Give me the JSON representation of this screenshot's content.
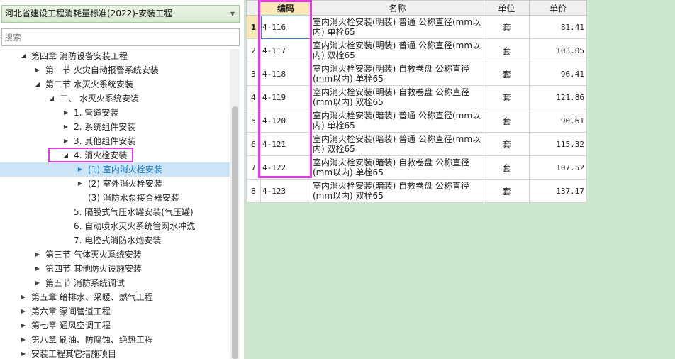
{
  "standard_selector": {
    "value": "河北省建设工程消耗量标准(2022)-安装工程"
  },
  "search": {
    "placeholder": "搜索"
  },
  "tree": [
    {
      "label": "第四章 消防设备安装工程",
      "expanded": true
    },
    {
      "label": "第一节 火灾自动报警系统安装",
      "expanded": false
    },
    {
      "label": "第二节 水灭火系统安装",
      "expanded": true
    },
    {
      "label": "二、 水灭火系统安装",
      "expanded": true
    },
    {
      "label": "1. 管道安装",
      "expanded": false
    },
    {
      "label": "2. 系统组件安装",
      "expanded": false
    },
    {
      "label": "3. 其他组件安装",
      "expanded": false
    },
    {
      "label": "4. 消火栓安装",
      "expanded": true,
      "highlighted": true
    },
    {
      "label": "(1) 室内消火栓安装",
      "expanded": false,
      "selected": true
    },
    {
      "label": "(2) 室外消火栓安装",
      "expanded": false
    },
    {
      "label": "(3) 消防水泵接合器安装",
      "leaf": true
    },
    {
      "label": "5. 隔膜式气压水罐安装(气压罐)",
      "leaf": true
    },
    {
      "label": "6. 自动喷水灭火系统管网水冲洗",
      "leaf": true
    },
    {
      "label": "7. 电控式消防水炮安装",
      "leaf": true
    },
    {
      "label": "第三节 气体灭火系统安装",
      "expanded": false
    },
    {
      "label": "第四节 其他防火设施安装",
      "expanded": false
    },
    {
      "label": "第五节 消防系统调试",
      "expanded": false
    },
    {
      "label": "第五章 给排水、采暖、燃气工程",
      "expanded": false
    },
    {
      "label": "第六章 泵间管道工程",
      "expanded": false
    },
    {
      "label": "第七章 通风空调工程",
      "expanded": false
    },
    {
      "label": "第八章 刷油、防腐蚀、绝热工程",
      "expanded": false
    },
    {
      "label": "安装工程其它措施项目",
      "expanded": false
    }
  ],
  "grid": {
    "headers": {
      "code": "编码",
      "name": "名称",
      "unit": "单位",
      "price": "单价"
    },
    "rows": [
      {
        "num": "1",
        "code": "4-116",
        "name1": "室内消火栓安装(明装) 普通 公称直径(mm以",
        "name2": "内) 单栓65",
        "unit": "套",
        "price": "81.41"
      },
      {
        "num": "2",
        "code": "4-117",
        "name1": "室内消火栓安装(明装) 普通 公称直径(mm以",
        "name2": "内) 双栓65",
        "unit": "套",
        "price": "103.05"
      },
      {
        "num": "3",
        "code": "4-118",
        "name1": "室内消火栓安装(明装) 自救卷盘 公称直径",
        "name2": "(mm以内) 单栓65",
        "unit": "套",
        "price": "96.41"
      },
      {
        "num": "4",
        "code": "4-119",
        "name1": "室内消火栓安装(明装) 自救卷盘 公称直径",
        "name2": "(mm以内) 双栓65",
        "unit": "套",
        "price": "121.86"
      },
      {
        "num": "5",
        "code": "4-120",
        "name1": "室内消火栓安装(暗装) 普通 公称直径(mm以",
        "name2": "内) 单栓65",
        "unit": "套",
        "price": "90.61"
      },
      {
        "num": "6",
        "code": "4-121",
        "name1": "室内消火栓安装(暗装) 普通 公称直径(mm以",
        "name2": "内) 双栓65",
        "unit": "套",
        "price": "115.32"
      },
      {
        "num": "7",
        "code": "4-122",
        "name1": "室内消火栓安装(暗装) 自救卷盘 公称直径",
        "name2": "(mm以内) 单栓65",
        "unit": "套",
        "price": "107.52"
      },
      {
        "num": "8",
        "code": "4-123",
        "name1": "室内消火栓安装(暗装) 自救卷盘 公称直径",
        "name2": "(mm以内) 双栓65",
        "unit": "套",
        "price": "137.17"
      }
    ]
  },
  "colors": {
    "highlight": "#e13ce0",
    "selected_bg": "#cce4f7",
    "selected_text": "#1a7cc9",
    "grid_bg": "#cce6cf",
    "active_header": "#fbe8b6"
  },
  "icons": {
    "expand": "triangle-right-icon",
    "collapse": "triangle-down-icon",
    "dropdown": "chevron-down-icon"
  }
}
